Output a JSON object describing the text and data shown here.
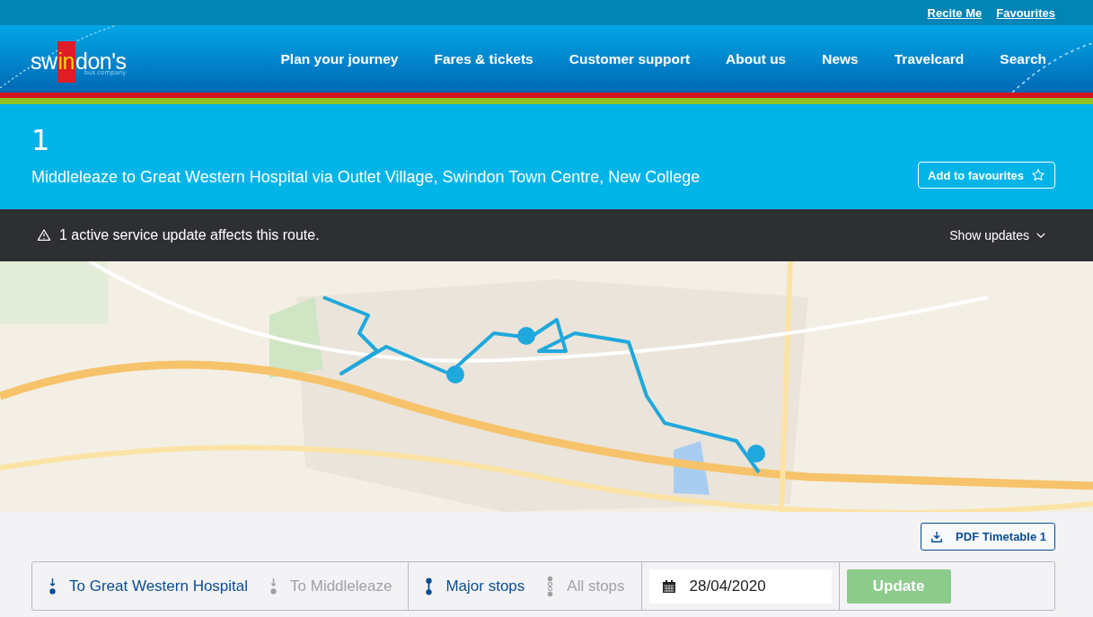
{
  "top_links": [
    "Recite Me",
    "Favourites"
  ],
  "logo": {
    "parts": [
      {
        "text": "sw",
        "highlight": false
      },
      {
        "text": "in",
        "highlight": true
      },
      {
        "text": "don's",
        "highlight": false
      }
    ],
    "tagline": "bus company"
  },
  "nav": [
    "Plan your journey",
    "Fares & tickets",
    "Customer support",
    "About us",
    "News",
    "Travelcard",
    "Search"
  ],
  "route": {
    "number": "1",
    "description": "Middleleaze to Great Western Hospital via Outlet Village, Swindon Town Centre, New College",
    "favourite_button": "Add to favourites"
  },
  "alert": {
    "message": "1 active service update affects this route.",
    "toggle": "Show updates"
  },
  "map": {
    "kind": "picture"
  },
  "pdf_button": "PDF Timetable 1",
  "directions": [
    {
      "label": "To Great Western Hospital",
      "selected": true
    },
    {
      "label": "To Middleleaze",
      "selected": false
    }
  ],
  "stops": [
    {
      "label": "Major stops",
      "selected": true
    },
    {
      "label": "All stops",
      "selected": false
    }
  ],
  "date": {
    "value": "28/04/2020"
  },
  "update_button": {
    "label": "Update",
    "disabled": true
  }
}
